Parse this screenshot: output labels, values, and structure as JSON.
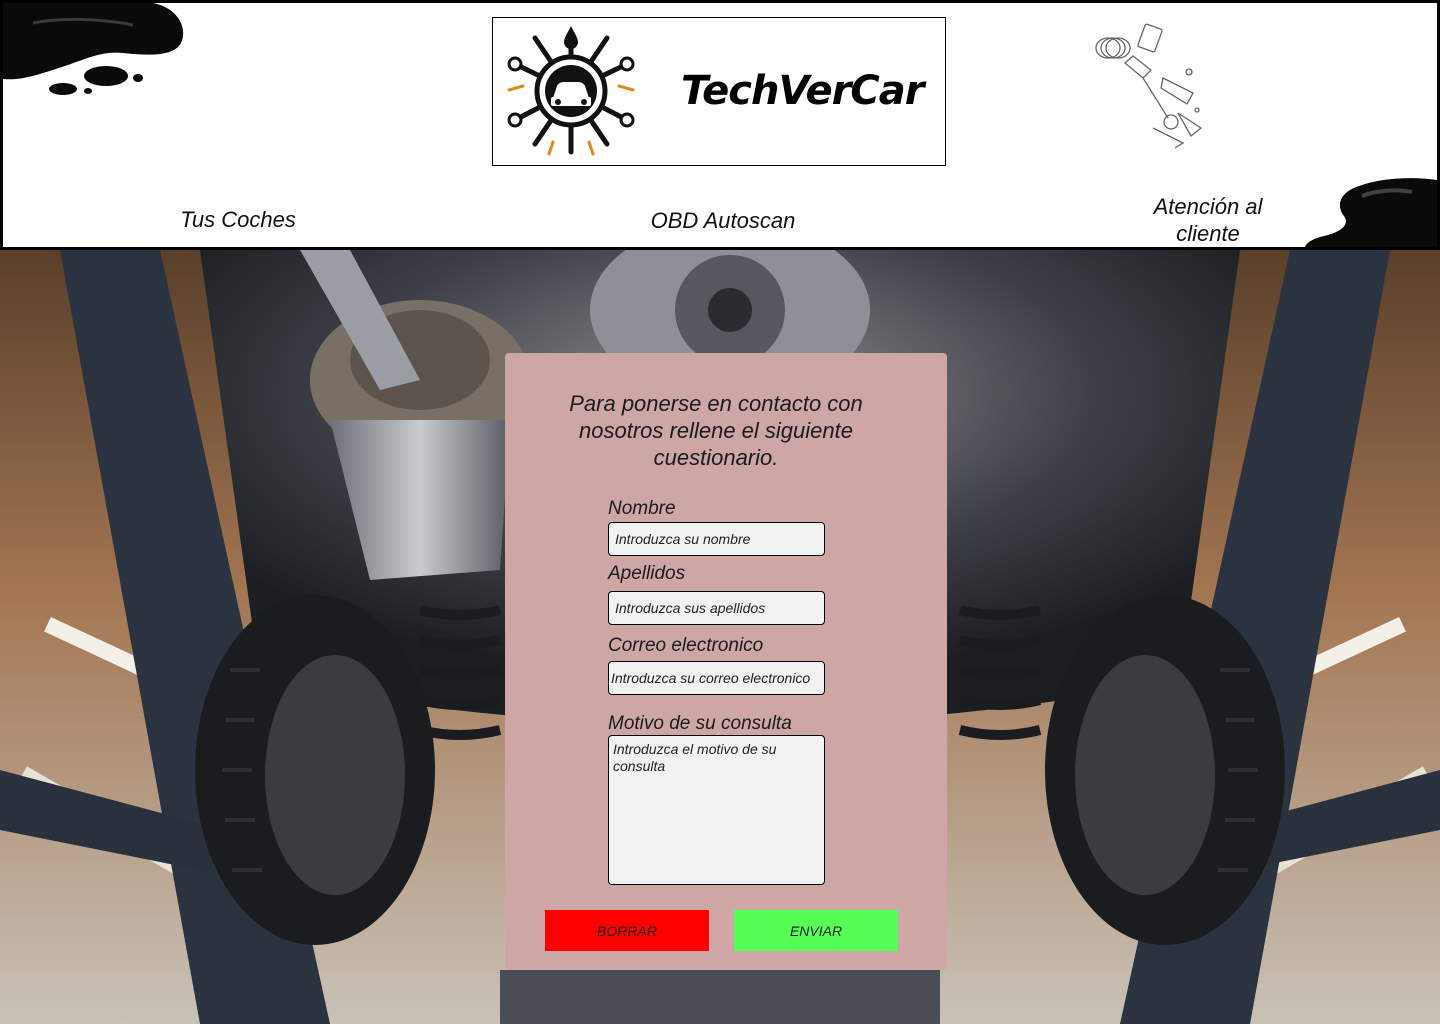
{
  "header": {
    "brand": "TechVerCar",
    "nav": {
      "tus_coches": "Tus Coches",
      "obd": "OBD Autoscan",
      "atencion": "Atención al cliente"
    }
  },
  "form": {
    "intro": "Para ponerse en contacto con nosotros rellene el siguiente cuestionario.",
    "nombre_label": "Nombre",
    "nombre_placeholder": "Introduzca su nombre",
    "apellidos_label": "Apellidos",
    "apellidos_placeholder": "Introduzca sus apellidos",
    "correo_label": "Correo electronico",
    "correo_placeholder": "Introduzca su correo electronico",
    "motivo_label": "Motivo de su consulta",
    "motivo_placeholder": "Introduzca el motivo de su consulta",
    "borrar_label": "BORRAR",
    "enviar_label": "ENVIAR"
  },
  "colors": {
    "panel": "#cea6a6",
    "borrar": "#ff0000",
    "enviar": "#56ff56"
  },
  "icons": [
    "oil-spill-icon",
    "mechanic-emblem-icon",
    "engine-parts-sketch-icon"
  ]
}
